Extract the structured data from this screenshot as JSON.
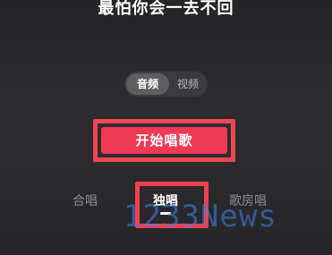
{
  "song": {
    "title": "最怕你会一去不回"
  },
  "mode_toggle": {
    "options": [
      "音频",
      "视频"
    ],
    "selected": "音频"
  },
  "start_button": {
    "label": "开始唱歌"
  },
  "singing_tabs": {
    "items": [
      "合唱",
      "独唱",
      "歌房唱"
    ],
    "selected": "独唱"
  },
  "watermark": {
    "text": "1233News"
  },
  "colors": {
    "accent": "#ee3a52",
    "highlight_outline": "#f24653",
    "background": "#2a2a2d",
    "watermark": "#3e82eb"
  }
}
